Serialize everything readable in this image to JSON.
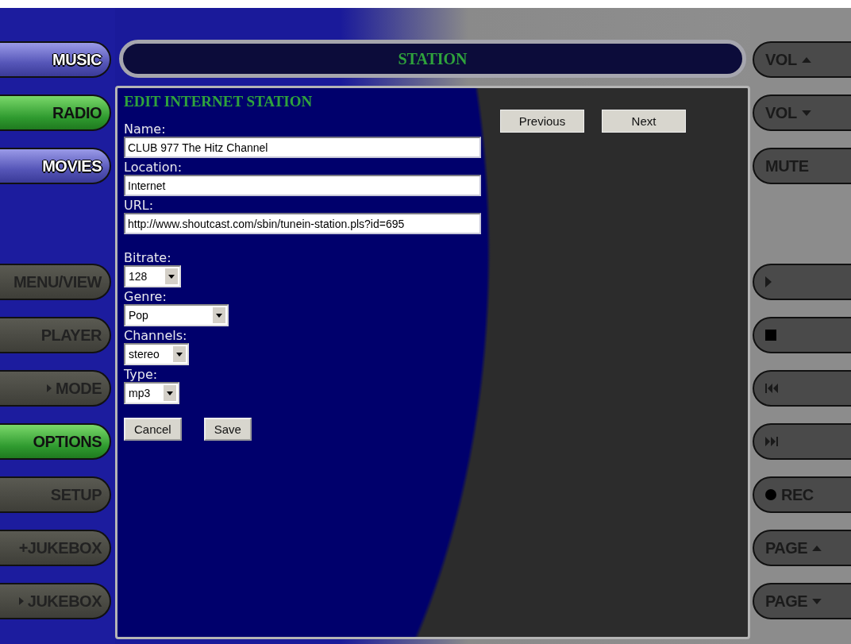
{
  "title_bar": {
    "title": "STATION"
  },
  "nav_primary": [
    {
      "label": "MUSIC",
      "selected": false
    },
    {
      "label": "RADIO",
      "selected": true
    },
    {
      "label": "MOVIES",
      "selected": false
    }
  ],
  "nav_secondary": [
    {
      "label": "MENU/VIEW",
      "kind": "plain",
      "selected": false
    },
    {
      "label": "PLAYER",
      "kind": "plain",
      "selected": false
    },
    {
      "label": "MODE",
      "kind": "play",
      "selected": false
    },
    {
      "label": "OPTIONS",
      "kind": "plain",
      "selected": true
    },
    {
      "label": "SETUP",
      "kind": "plain",
      "selected": false
    },
    {
      "label": "+JUKEBOX",
      "kind": "plain",
      "selected": false
    },
    {
      "label": "JUKEBOX",
      "kind": "play",
      "selected": false
    }
  ],
  "controls_top": [
    {
      "label": "VOL",
      "kind": "up"
    },
    {
      "label": "VOL",
      "kind": "down"
    },
    {
      "label": "MUTE",
      "kind": "plain"
    }
  ],
  "controls_bottom": [
    {
      "kind": "play"
    },
    {
      "kind": "stop"
    },
    {
      "kind": "prev"
    },
    {
      "kind": "next"
    },
    {
      "label": "REC",
      "kind": "rec"
    },
    {
      "label": "PAGE",
      "kind": "up"
    },
    {
      "label": "PAGE",
      "kind": "down"
    }
  ],
  "form": {
    "heading": "EDIT INTERNET STATION",
    "text_fields": [
      {
        "label": "Name:",
        "value": "CLUB 977 The Hitz Channel"
      },
      {
        "label": "Location:",
        "value": "Internet"
      },
      {
        "label": "URL:",
        "value": "http://www.shoutcast.com/sbin/tunein-station.pls?id=695"
      }
    ],
    "dropdowns": [
      {
        "label": "Bitrate:",
        "value": "128"
      },
      {
        "label": "Genre:",
        "value": "Pop"
      },
      {
        "label": "Channels:",
        "value": "stereo"
      },
      {
        "label": "Type:",
        "value": "mp3"
      }
    ],
    "buttons": [
      "Cancel",
      "Save"
    ]
  },
  "pager": [
    "Previous",
    "Next"
  ]
}
